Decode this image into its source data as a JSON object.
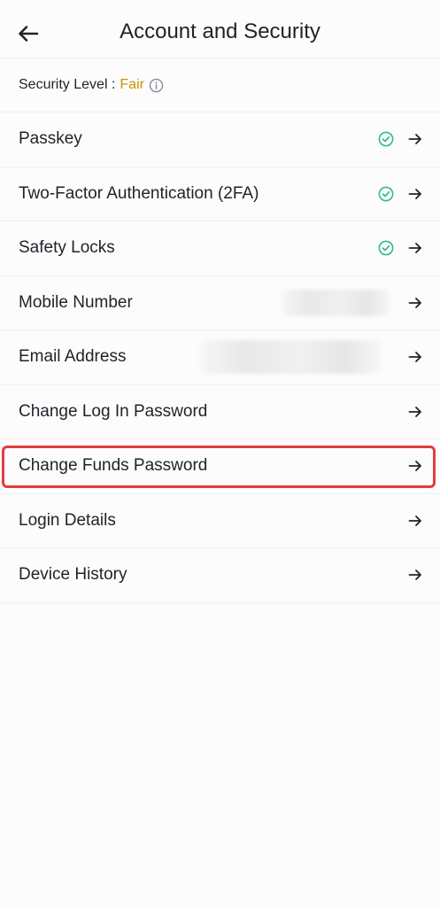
{
  "header": {
    "title": "Account and Security",
    "back_icon": "arrow-left-icon"
  },
  "security": {
    "label": "Security Level :",
    "value": "Fair",
    "value_color": "#c99400",
    "info_icon": "info-circle-icon"
  },
  "items": [
    {
      "label": "Passkey",
      "verified": true
    },
    {
      "label": "Two-Factor Authentication (2FA)",
      "verified": true
    },
    {
      "label": "Safety Locks",
      "verified": true
    },
    {
      "label": "Mobile Number",
      "verified": false,
      "value_redacted": true
    },
    {
      "label": "Email Address",
      "verified": false,
      "value_redacted": true
    },
    {
      "label": "Change Log In Password",
      "verified": false
    },
    {
      "label": "Change Funds Password",
      "verified": false,
      "highlighted": true
    },
    {
      "label": "Login Details",
      "verified": false
    },
    {
      "label": "Device History",
      "verified": false
    }
  ],
  "colors": {
    "check_green": "#2ebd85",
    "highlight_red": "#e23c3f",
    "text_primary": "#1e2329"
  }
}
